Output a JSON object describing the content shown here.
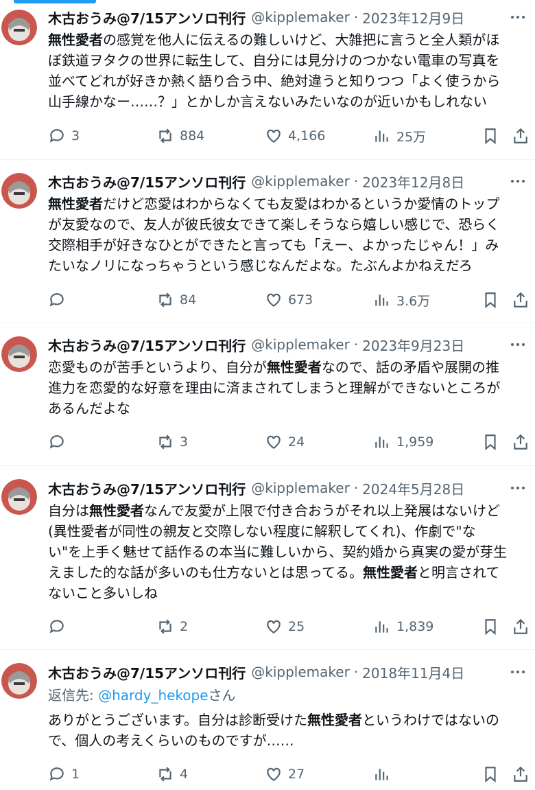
{
  "colors": {
    "accent": "#1d9bf0",
    "secondary_text": "#536471",
    "text": "#0f1419"
  },
  "icons": {
    "reply": "reply-bubble-icon",
    "repost": "repost-icon",
    "like": "heart-icon",
    "views": "bar-chart-icon",
    "bookmark": "bookmark-icon",
    "share": "share-icon",
    "more": "more-dots-icon"
  },
  "tweets": [
    {
      "name": "木古おうみ@7/15アンソロ刊行",
      "handle": "@kipplemaker",
      "date": "2023年12月9日",
      "lines": [
        [
          {
            "t": "無性愛者",
            "b": true
          },
          {
            "t": "の感覚を他人に伝えるの難しいけど、大雑把に言うと全人類がほ"
          }
        ],
        [
          {
            "t": "ぼ鉄道ヲタクの世界に転生して、自分には見分けのつかない電車の写真を"
          }
        ],
        [
          {
            "t": "並べてどれが好きか熱く語り合う中、絶対違うと知りつつ「よく使うから"
          }
        ],
        [
          {
            "t": "山手線かなー……？」とかしか言えないみたいなのが近いかもしれない"
          }
        ]
      ],
      "replies": "3",
      "reposts": "884",
      "likes": "4,166",
      "views": "25万"
    },
    {
      "name": "木古おうみ@7/15アンソロ刊行",
      "handle": "@kipplemaker",
      "date": "2023年12月8日",
      "lines": [
        [
          {
            "t": "無性愛者",
            "b": true
          },
          {
            "t": "だけど恋愛はわからなくても友愛はわかるというか愛情のトップ"
          }
        ],
        [
          {
            "t": "が友愛なので、友人が彼氏彼女できて楽しそうなら嬉しい感じで、恐らく"
          }
        ],
        [
          {
            "t": "交際相手が好きなひとができたと言っても「えー、よかったじゃん！」み"
          }
        ],
        [
          {
            "t": "たいなノリになっちゃうという感じなんだよな。たぶんよかねえだろ"
          }
        ]
      ],
      "replies": "",
      "reposts": "84",
      "likes": "673",
      "views": "3.6万"
    },
    {
      "name": "木古おうみ@7/15アンソロ刊行",
      "handle": "@kipplemaker",
      "date": "2023年9月23日",
      "lines": [
        [
          {
            "t": "恋愛ものが苦手というより、自分が"
          },
          {
            "t": "無性愛者",
            "b": true
          },
          {
            "t": "なので、話の矛盾や展開の推"
          }
        ],
        [
          {
            "t": "進力を恋愛的な好意を理由に済まされてしまうと理解ができないところが"
          }
        ],
        [
          {
            "t": "あるんだよな"
          }
        ]
      ],
      "replies": "",
      "reposts": "3",
      "likes": "24",
      "views": "1,959"
    },
    {
      "name": "木古おうみ@7/15アンソロ刊行",
      "handle": "@kipplemaker",
      "date": "2024年5月28日",
      "lines": [
        [
          {
            "t": "自分は"
          },
          {
            "t": "無性愛者",
            "b": true
          },
          {
            "t": "なんで友愛が上限で付き合おうがそれ以上発展はないけど"
          }
        ],
        [
          {
            "t": "(異性愛者が同性の親友と交際しない程度に解釈してくれ)、作劇で\"な"
          }
        ],
        [
          {
            "t": "い\"を上手く魅せて話作るの本当に難しいから、契約婚から真実の愛が芽生"
          }
        ],
        [
          {
            "t": "えました的な話が多いのも仕方ないとは思ってる。"
          },
          {
            "t": "無性愛者",
            "b": true
          },
          {
            "t": "と明言されて"
          }
        ],
        [
          {
            "t": "ないこと多いしね"
          }
        ]
      ],
      "replies": "",
      "reposts": "2",
      "likes": "25",
      "views": "1,839"
    },
    {
      "name": "木古おうみ@7/15アンソロ刊行",
      "handle": "@kipplemaker",
      "date": "2018年11月4日",
      "reply_prefix": "返信先: ",
      "reply_mention": "@hardy_hekope",
      "reply_suffix": "さん",
      "lines": [
        [
          {
            "t": "ありがとうございます。自分は診断受けた"
          },
          {
            "t": "無性愛者",
            "b": true
          },
          {
            "t": "というわけではないの"
          }
        ],
        [
          {
            "t": "で、個人の考えくらいのものですが……"
          }
        ]
      ],
      "replies": "1",
      "reposts": "4",
      "likes": "27",
      "views": ""
    }
  ]
}
